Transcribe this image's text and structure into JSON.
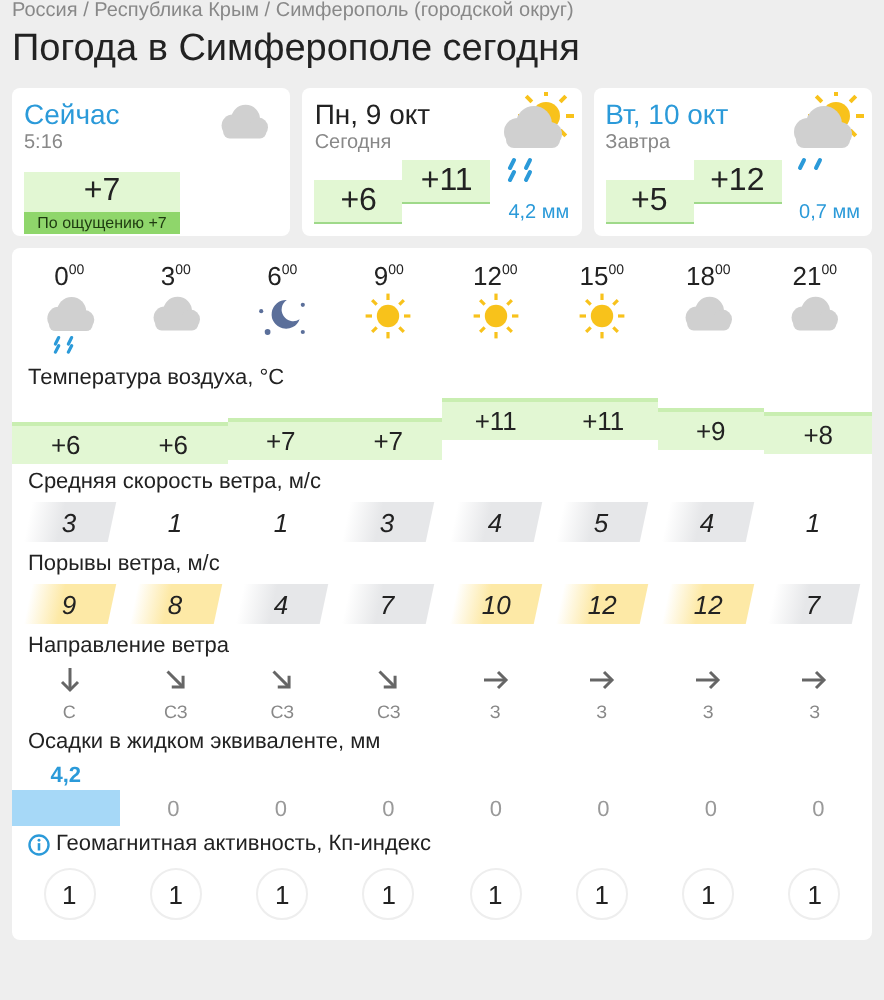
{
  "breadcrumb": "Россия / Республика Крым / Симферополь (городской округ)",
  "title": "Погода в Симферополе сегодня",
  "now": {
    "label": "Сейчас",
    "time": "5:16",
    "kind": "cloudy",
    "temperature": "+7",
    "feels_like": "По ощущению +7"
  },
  "days": [
    {
      "date": "Пн, 9 окт",
      "relative": "Сегодня",
      "min": "+6",
      "max": "+11",
      "kind": "sun-rain",
      "precipitation": "4,2 мм"
    },
    {
      "date": "Вт, 10 окт",
      "relative": "Завтра",
      "min": "+5",
      "max": "+12",
      "kind": "sun-light-rain",
      "precipitation": "0,7 мм"
    }
  ],
  "hours": [
    {
      "hour": "0",
      "minutes": "00",
      "kind": "rain"
    },
    {
      "hour": "3",
      "minutes": "00",
      "kind": "cloudy"
    },
    {
      "hour": "6",
      "minutes": "00",
      "kind": "night"
    },
    {
      "hour": "9",
      "minutes": "00",
      "kind": "sunny"
    },
    {
      "hour": "12",
      "minutes": "00",
      "kind": "sunny"
    },
    {
      "hour": "15",
      "minutes": "00",
      "kind": "sunny"
    },
    {
      "hour": "18",
      "minutes": "00",
      "kind": "cloudy"
    },
    {
      "hour": "21",
      "minutes": "00",
      "kind": "cloudy"
    }
  ],
  "temperature": {
    "label": "Температура воздуха, °C",
    "values": [
      "+6",
      "+6",
      "+7",
      "+7",
      "+11",
      "+11",
      "+9",
      "+8"
    ]
  },
  "wind_speed": {
    "label": "Средняя скорость ветра, м/с",
    "values": [
      {
        "value": "3",
        "kind": "gray"
      },
      {
        "value": "1",
        "kind": "plain"
      },
      {
        "value": "1",
        "kind": "plain"
      },
      {
        "value": "3",
        "kind": "gray"
      },
      {
        "value": "4",
        "kind": "gray"
      },
      {
        "value": "5",
        "kind": "gray"
      },
      {
        "value": "4",
        "kind": "gray"
      },
      {
        "value": "1",
        "kind": "plain"
      }
    ]
  },
  "wind_gusts": {
    "label": "Порывы ветра, м/с",
    "values": [
      {
        "value": "9",
        "kind": "yellow"
      },
      {
        "value": "8",
        "kind": "yellow"
      },
      {
        "value": "4",
        "kind": "gray"
      },
      {
        "value": "7",
        "kind": "gray"
      },
      {
        "value": "10",
        "kind": "yellow"
      },
      {
        "value": "12",
        "kind": "yellow"
      },
      {
        "value": "12",
        "kind": "yellow"
      },
      {
        "value": "7",
        "kind": "gray"
      }
    ]
  },
  "wind_direction": {
    "label": "Направление ветра",
    "values": [
      {
        "kind": "down",
        "name": "С"
      },
      {
        "kind": "down-right",
        "name": "СЗ"
      },
      {
        "kind": "down-right",
        "name": "СЗ"
      },
      {
        "kind": "down-right",
        "name": "СЗ"
      },
      {
        "kind": "right",
        "name": "З"
      },
      {
        "kind": "right",
        "name": "З"
      },
      {
        "kind": "right",
        "name": "З"
      },
      {
        "kind": "right",
        "name": "З"
      }
    ]
  },
  "precipitation": {
    "label": "Осадки в жидком эквиваленте, мм",
    "values": [
      "4,2",
      "0",
      "0",
      "0",
      "0",
      "0",
      "0",
      "0"
    ]
  },
  "geomagnetic": {
    "label": "Геомагнитная активность, Кп-индекс",
    "values": [
      "1",
      "1",
      "1",
      "1",
      "1",
      "1",
      "1",
      "1"
    ]
  }
}
